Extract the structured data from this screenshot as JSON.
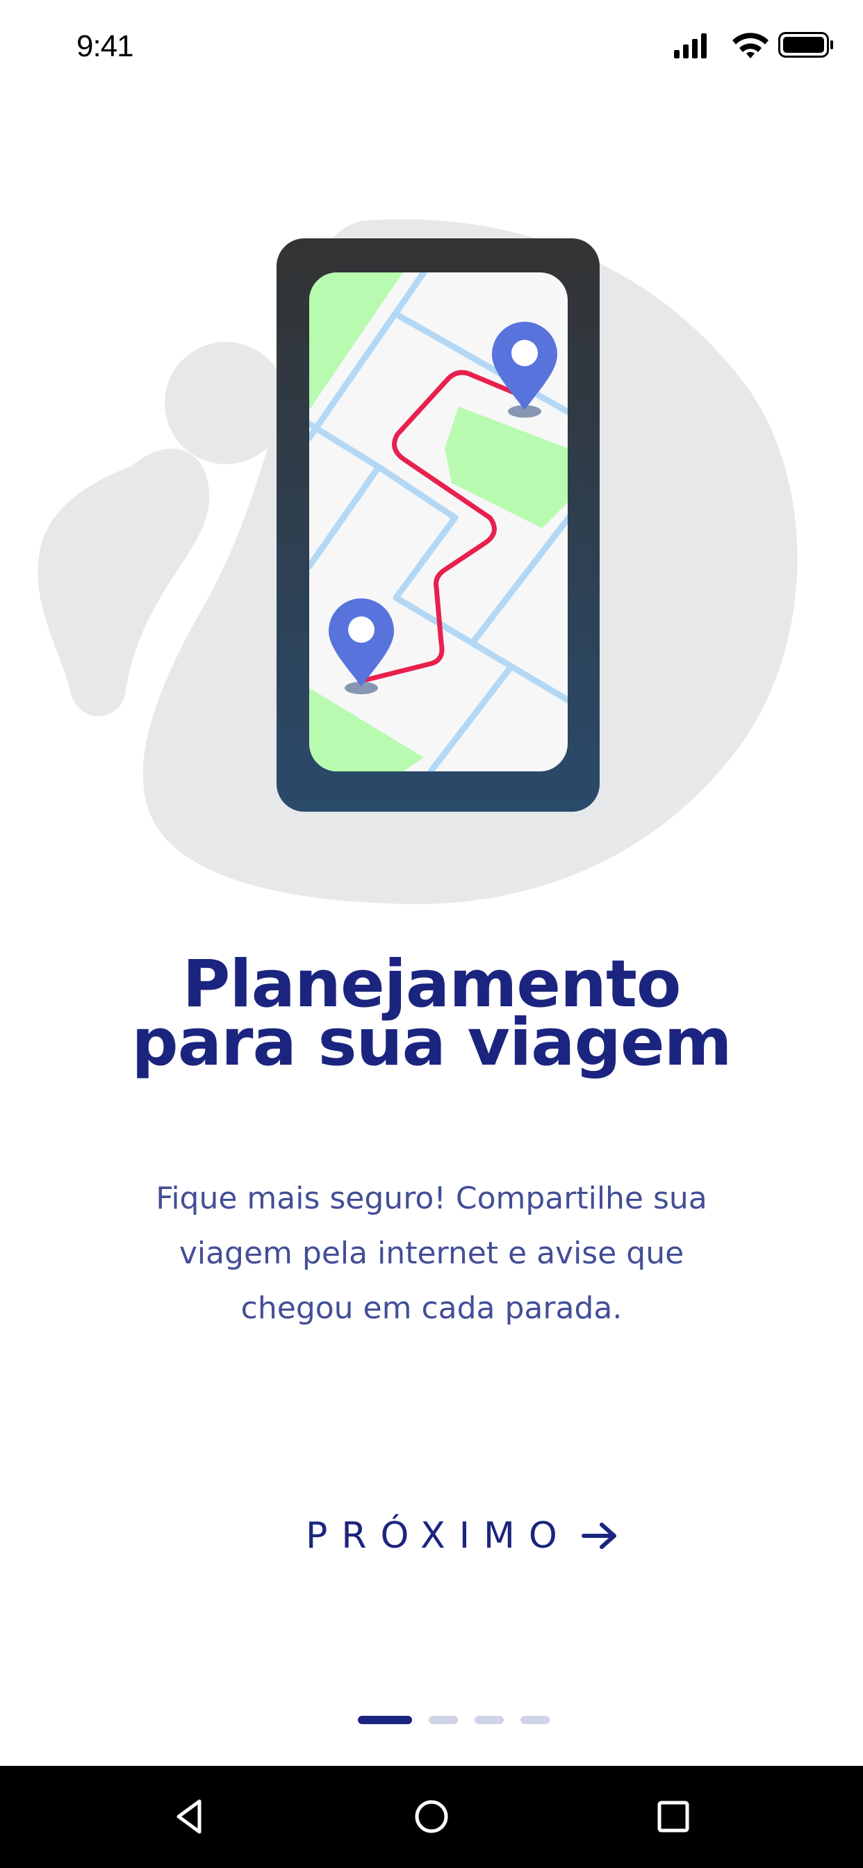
{
  "status_bar": {
    "time": "9:41"
  },
  "illustration": {
    "icons": [
      "phone-illustration",
      "map-route",
      "location-pin-icon",
      "location-pin-icon"
    ],
    "colors": {
      "blob": "#e6e8e9",
      "phone_top": "#333333",
      "phone_bottom": "#2a4a6b",
      "map_bg": "#f7f7f8",
      "road": "#b3d8f5",
      "park": "#b8fbb0",
      "route": "#e8204d",
      "pin": "#5873dc"
    }
  },
  "onboarding": {
    "title_line1": "Planejamento",
    "title_line2": "para sua viagem",
    "description": "Fique mais seguro! Compartilhe sua viagem pela internet e avise que chegou em cada parada.",
    "next_label": "PRÓXIMO",
    "pager": {
      "total": 4,
      "current": 1
    }
  },
  "navigation_bar": {
    "buttons": [
      "back-icon",
      "home-icon",
      "recents-icon"
    ]
  },
  "colors": {
    "primary": "#1b257f",
    "text_secondary": "#434e96",
    "pager_inactive": "#d1d3e6"
  }
}
